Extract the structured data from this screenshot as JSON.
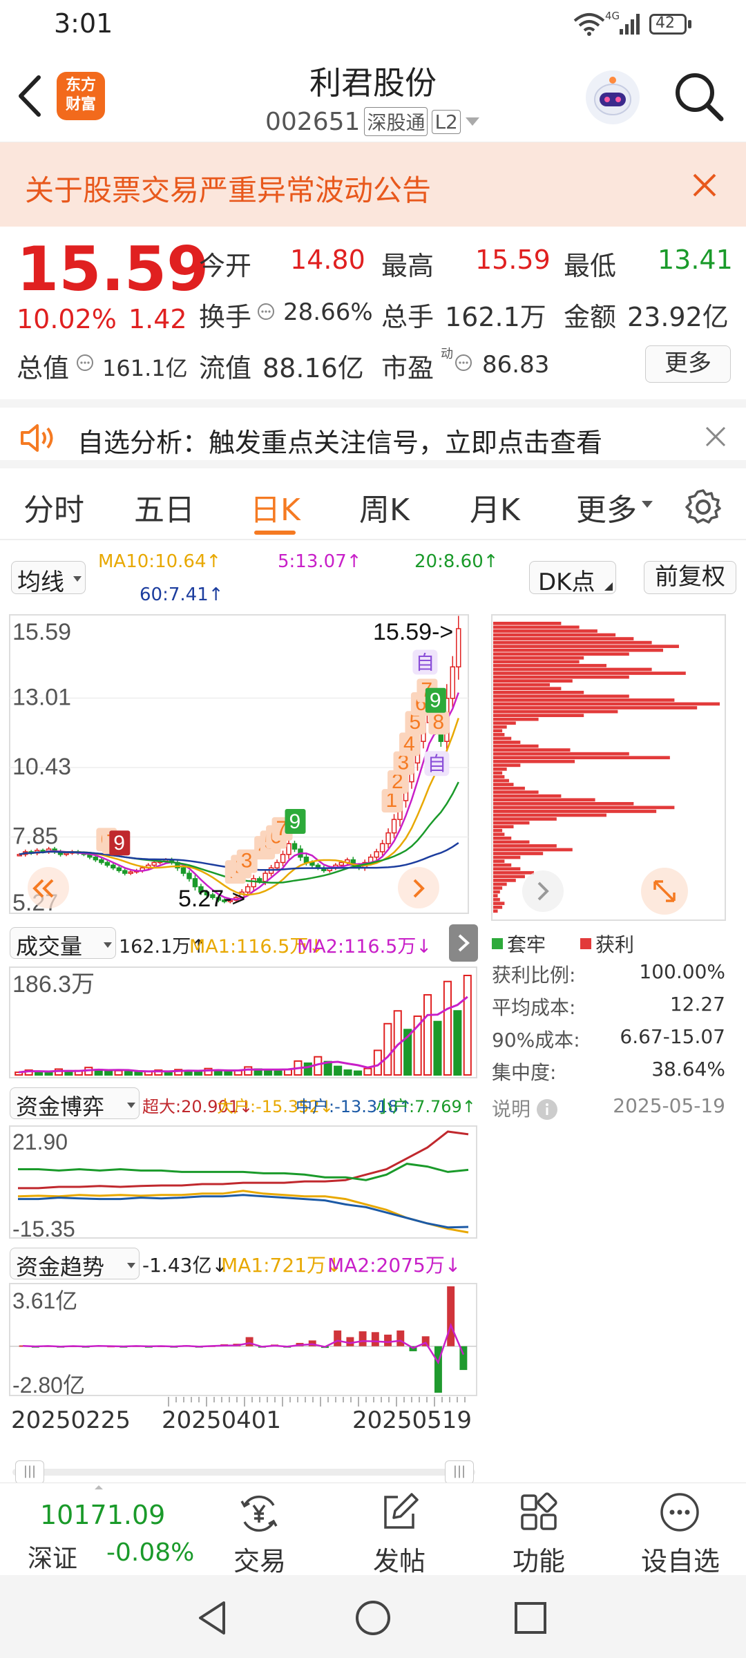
{
  "status": {
    "time": "3:01",
    "network": "4G",
    "battery": "42"
  },
  "header": {
    "app_badge_line1": "东方",
    "app_badge_line2": "财富",
    "stock_name": "利君股份",
    "stock_code": "002651",
    "tag1": "深股通",
    "tag2": "L2"
  },
  "notice": {
    "text": "关于股票交易严重异常波动公告"
  },
  "quote": {
    "price": "15.59",
    "change_pct": "10.02%",
    "change": "1.42",
    "open_label": "今开",
    "open": "14.80",
    "high_label": "最高",
    "high": "15.59",
    "low_label": "最低",
    "low": "13.41",
    "turnover_label": "换手",
    "turnover": "28.66%",
    "volume_label": "总手",
    "volume": "162.1万",
    "amount_label": "金额",
    "amount": "23.92亿",
    "mktcap_label": "总值",
    "mktcap": "161.1亿",
    "float_label": "流值",
    "float": "88.16亿",
    "pe_label": "市盈",
    "pe_sup": "动",
    "pe": "86.83",
    "more_label": "更多"
  },
  "signal": {
    "text": "自选分析：触发重点关注信号，立即点击查看"
  },
  "tabs": [
    "分时",
    "五日",
    "日K",
    "周K",
    "月K",
    "更多"
  ],
  "active_tab": "日K",
  "chart_toolbar": {
    "ma_select": "均线",
    "ma10": "MA10:10.64↑",
    "ma5": "5:13.07↑",
    "ma20": "20:8.60↑",
    "ma60": "60:7.41↑",
    "dk_label": "DK点",
    "adjust_label": "前复权"
  },
  "colors": {
    "up": "#e02020",
    "down": "#1a9a2a",
    "accent": "#f57a22",
    "ma5": "#c81fc8",
    "ma10": "#e8a800",
    "ma20": "#1a9a2a",
    "ma60": "#1c3d9e"
  },
  "chart_data": [
    {
      "type": "candlestick",
      "title": "日K",
      "price_axis_ticks": [
        "15.59",
        "13.01",
        "10.43",
        "7.85",
        "5.27"
      ],
      "ylim": [
        5.27,
        15.59
      ],
      "high_marker": "15.59->",
      "low_marker": "5.27->",
      "signal_markers": [
        "1",
        "2",
        "3",
        "4",
        "5",
        "6",
        "7",
        "8",
        "9",
        "自"
      ],
      "close": [
        7.2,
        7.3,
        7.25,
        7.35,
        7.3,
        7.4,
        7.3,
        7.2,
        7.25,
        7.3,
        7.25,
        7.2,
        7.1,
        7.0,
        6.9,
        6.8,
        6.7,
        6.6,
        6.5,
        6.55,
        6.6,
        6.7,
        6.8,
        6.9,
        6.95,
        7.0,
        6.9,
        6.7,
        6.5,
        6.3,
        6.0,
        5.8,
        5.7,
        5.6,
        5.5,
        5.45,
        5.5,
        5.6,
        5.8,
        6.0,
        6.3,
        6.2,
        6.5,
        6.7,
        6.9,
        7.2,
        7.6,
        7.4,
        7.1,
        6.9,
        6.8,
        6.7,
        6.6,
        6.7,
        6.8,
        6.9,
        7.0,
        6.8,
        6.7,
        6.9,
        7.1,
        7.3,
        7.6,
        8.0,
        8.5,
        9.2,
        9.9,
        10.6,
        11.4,
        12.1,
        12.6,
        11.9,
        11.4,
        13.0,
        14.17,
        15.59
      ],
      "ma_series": [
        {
          "name": "MA5",
          "last": 13.07
        },
        {
          "name": "MA10",
          "last": 10.64
        },
        {
          "name": "MA20",
          "last": 8.6
        },
        {
          "name": "MA60",
          "last": 7.41
        }
      ]
    },
    {
      "type": "bar",
      "title": "成交量",
      "header_value": "162.1万↑",
      "ma1": "MA1:116.5万↓",
      "ma2": "MA2:116.5万↓",
      "ymax_label": "186.3万",
      "values": [
        5,
        9,
        7,
        5,
        11,
        6,
        8,
        14,
        10,
        7,
        8,
        6,
        5,
        7,
        9,
        6,
        10,
        8,
        6,
        12,
        9,
        7,
        8,
        15,
        11,
        9,
        7,
        10,
        26,
        22,
        34,
        25,
        16,
        9,
        7,
        12,
        46,
        96,
        120,
        85,
        110,
        150,
        100,
        175,
        120,
        186.3
      ]
    },
    {
      "type": "line",
      "title": "资金博弈",
      "legend": [
        "超大:20.901↓",
        "大户:-15.352↓",
        "中户:-13.318↑",
        "小户:7.769↑"
      ],
      "y_top_label": "21.90",
      "y_bottom_label": "-15.35",
      "ylim": [
        -15.35,
        21.9
      ],
      "series": [
        {
          "name": "超大",
          "color": "#c0282d",
          "values": [
            1,
            1,
            1.5,
            1.5,
            1.8,
            1.5,
            1.8,
            2,
            2,
            2.5,
            2.5,
            3,
            3,
            3,
            3.5,
            3.5,
            4,
            6,
            8,
            12,
            16,
            21.9,
            20.9
          ]
        },
        {
          "name": "大户",
          "color": "#e8a800",
          "values": [
            -2,
            -1.8,
            -2,
            -1.5,
            -1.8,
            -1.5,
            -1.8,
            -1.5,
            -1.5,
            -1,
            -1,
            0,
            -1,
            -1.5,
            -2,
            -2,
            -3,
            -5,
            -7,
            -10,
            -12,
            -14,
            -15.35
          ]
        },
        {
          "name": "中户",
          "color": "#1c5aa6",
          "values": [
            -3,
            -3,
            -2.5,
            -2.8,
            -3,
            -3,
            -2.5,
            -2.8,
            -2.5,
            -2,
            -2,
            -1.5,
            -2,
            -2.5,
            -3,
            -3.5,
            -5,
            -6,
            -8,
            -10,
            -12,
            -13.5,
            -13.318
          ]
        },
        {
          "name": "小户",
          "color": "#1a9a2a",
          "values": [
            8,
            8,
            7.5,
            8,
            7.5,
            8,
            7.5,
            7.5,
            7,
            7,
            7,
            7,
            6.5,
            6.5,
            6,
            5,
            5,
            4,
            6,
            10,
            9,
            7,
            7.769
          ]
        }
      ]
    },
    {
      "type": "bar",
      "title": "资金趋势",
      "header_value": "-1.43亿↓",
      "ma1": "MA1:721万↓",
      "ma2": "MA2:2075万↓",
      "y_top_label": "3.61亿",
      "y_bottom_label": "-2.80亿",
      "ylim": [
        -2.8,
        3.61
      ],
      "values": [
        0.05,
        -0.03,
        0.04,
        -0.05,
        0.03,
        -0.04,
        0.05,
        0.02,
        -0.03,
        0.04,
        -0.02,
        0.03,
        -0.04,
        0.06,
        -0.05,
        0.04,
        0.12,
        0.15,
        0.55,
        -0.08,
        0.1,
        -0.05,
        0.2,
        0.35,
        -0.1,
        0.95,
        0.55,
        0.9,
        0.85,
        0.7,
        0.95,
        -0.3,
        0.6,
        -2.8,
        3.61,
        -1.43
      ],
      "date_labels": [
        "20250225",
        "20250401",
        "20250519"
      ]
    },
    {
      "type": "bar",
      "title": "筹码分布",
      "legend": [
        "套牢",
        "获利"
      ],
      "stats": [
        {
          "label": "获利比例:",
          "value": "100.00%"
        },
        {
          "label": "平均成本:",
          "value": "12.27"
        },
        {
          "label": "90%成本:",
          "value": "6.67-15.07"
        },
        {
          "label": "集中度:",
          "value": "38.64%"
        }
      ],
      "note_label": "说明",
      "date": "2025-05-19",
      "values": [
        2,
        4,
        5,
        3,
        2,
        3,
        4,
        6,
        10,
        14,
        18,
        12,
        8,
        5,
        12,
        22,
        35,
        28,
        16,
        8,
        5,
        4,
        9,
        16,
        28,
        50,
        72,
        80,
        62,
        45,
        30,
        20,
        14,
        9,
        7,
        5,
        4,
        6,
        12,
        36,
        78,
        60,
        34,
        20,
        12,
        8,
        5,
        4,
        6,
        10,
        20,
        40,
        55,
        90,
        100,
        80,
        60,
        40,
        30,
        25,
        35,
        60,
        85,
        70,
        50,
        38,
        40,
        60,
        75,
        82,
        70,
        62,
        54,
        46,
        38,
        30
      ]
    }
  ],
  "bottom_bar": {
    "index_value": "10171.09",
    "index_name": "深证",
    "index_change": "-0.08%",
    "items": [
      "交易",
      "发帖",
      "功能",
      "设自选"
    ]
  }
}
